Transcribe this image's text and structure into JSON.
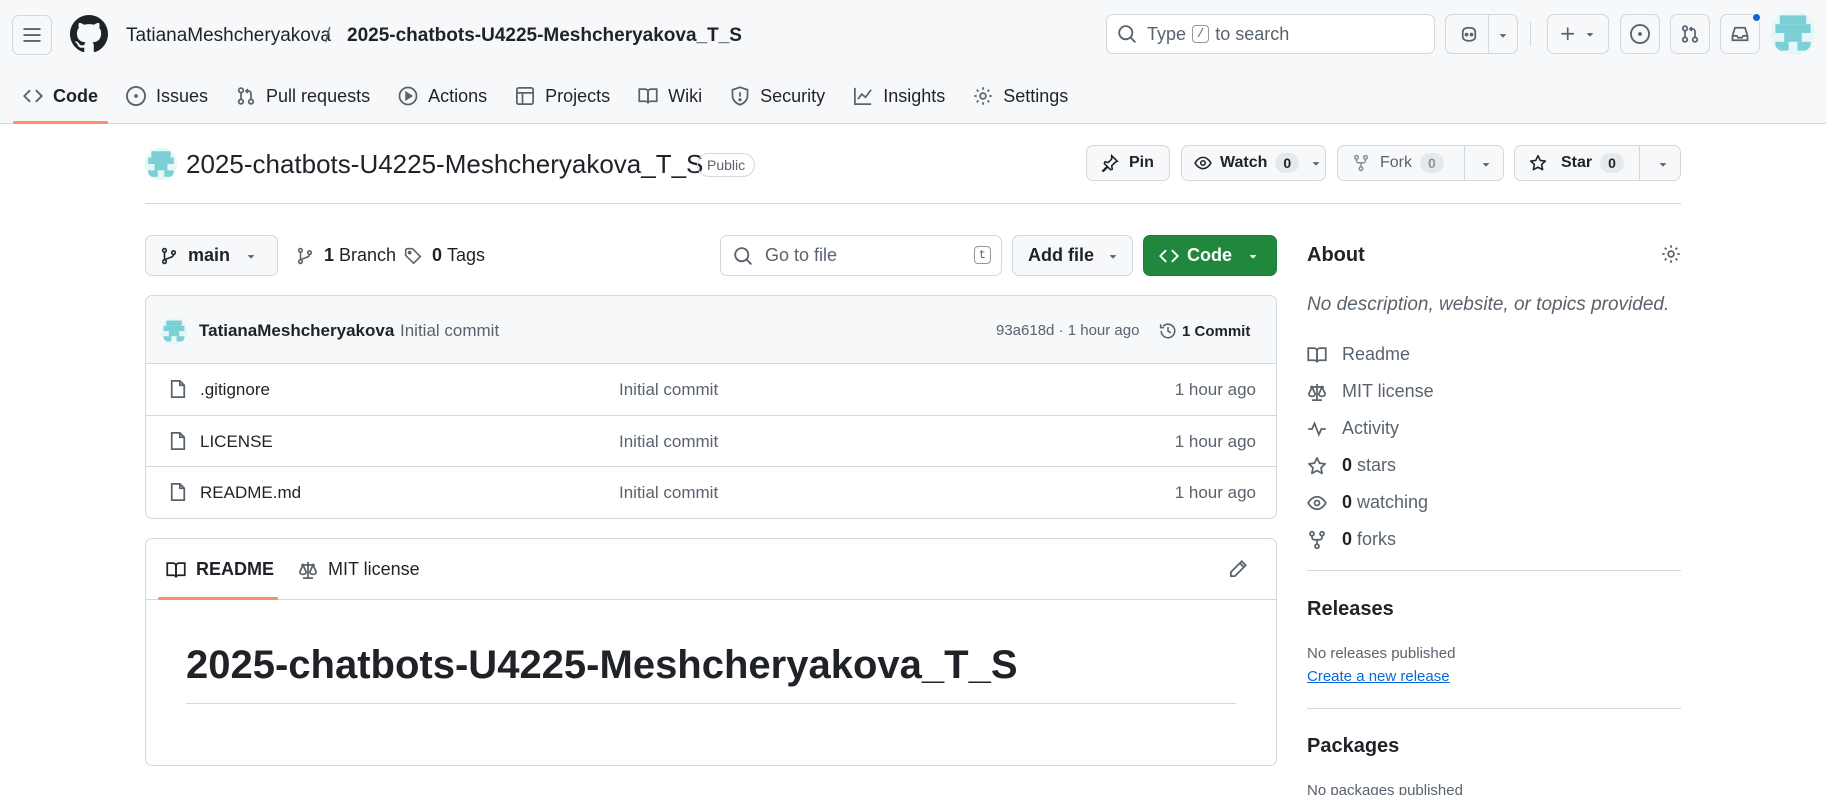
{
  "header": {
    "owner": "TatianaMeshcheryakova",
    "separator": "/",
    "repo": "2025-chatbots-U4225-Meshcheryakova_T_S",
    "search_prefix": "Type",
    "search_key": "/",
    "search_suffix": "to search"
  },
  "nav": {
    "items": [
      {
        "label": "Code",
        "icon": "code-icon",
        "active": true
      },
      {
        "label": "Issues",
        "icon": "issue-icon"
      },
      {
        "label": "Pull requests",
        "icon": "pull-request-icon"
      },
      {
        "label": "Actions",
        "icon": "play-icon"
      },
      {
        "label": "Projects",
        "icon": "table-icon"
      },
      {
        "label": "Wiki",
        "icon": "book-icon"
      },
      {
        "label": "Security",
        "icon": "shield-icon"
      },
      {
        "label": "Insights",
        "icon": "graph-icon"
      },
      {
        "label": "Settings",
        "icon": "gear-icon"
      }
    ]
  },
  "repo": {
    "title": "2025-chatbots-U4225-Meshcheryakova_T_S",
    "visibility": "Public",
    "pin_label": "Pin",
    "watch_label": "Watch",
    "watch_count": "0",
    "fork_label": "Fork",
    "fork_count": "0",
    "star_label": "Star",
    "star_count": "0"
  },
  "branchbar": {
    "branch": "main",
    "branch_count": "1",
    "branch_label": "Branch",
    "tag_count": "0",
    "tag_label": "Tags",
    "goto_placeholder": "Go to file",
    "goto_key": "t",
    "addfile_label": "Add file",
    "code_label": "Code"
  },
  "commit": {
    "author": "TatianaMeshcheryakova",
    "message": "Initial commit",
    "meta": "93a618d · 1 hour ago",
    "count_label": "1 Commit"
  },
  "files": [
    {
      "name": ".gitignore",
      "message": "Initial commit",
      "time": "1 hour ago"
    },
    {
      "name": "LICENSE",
      "message": "Initial commit",
      "time": "1 hour ago"
    },
    {
      "name": "README.md",
      "message": "Initial commit",
      "time": "1 hour ago"
    }
  ],
  "readme": {
    "tab_readme": "README",
    "tab_license": "MIT license",
    "heading": "2025-chatbots-U4225-Meshcheryakova_T_S"
  },
  "about": {
    "title": "About",
    "description": "No description, website, or topics provided.",
    "readme": "Readme",
    "license": "MIT license",
    "activity": "Activity",
    "stars_count": "0",
    "stars_label": "stars",
    "watching_count": "0",
    "watching_label": "watching",
    "forks_count": "0",
    "forks_label": "forks"
  },
  "releases": {
    "title": "Releases",
    "none": "No releases published",
    "create_link": "Create a new release"
  },
  "packages": {
    "title": "Packages",
    "none": "No packages published"
  },
  "colors": {
    "accent_underline": "#fd8c73",
    "code_button": "#1f883d",
    "link": "#0969da",
    "notification_dot": "#0969da"
  }
}
